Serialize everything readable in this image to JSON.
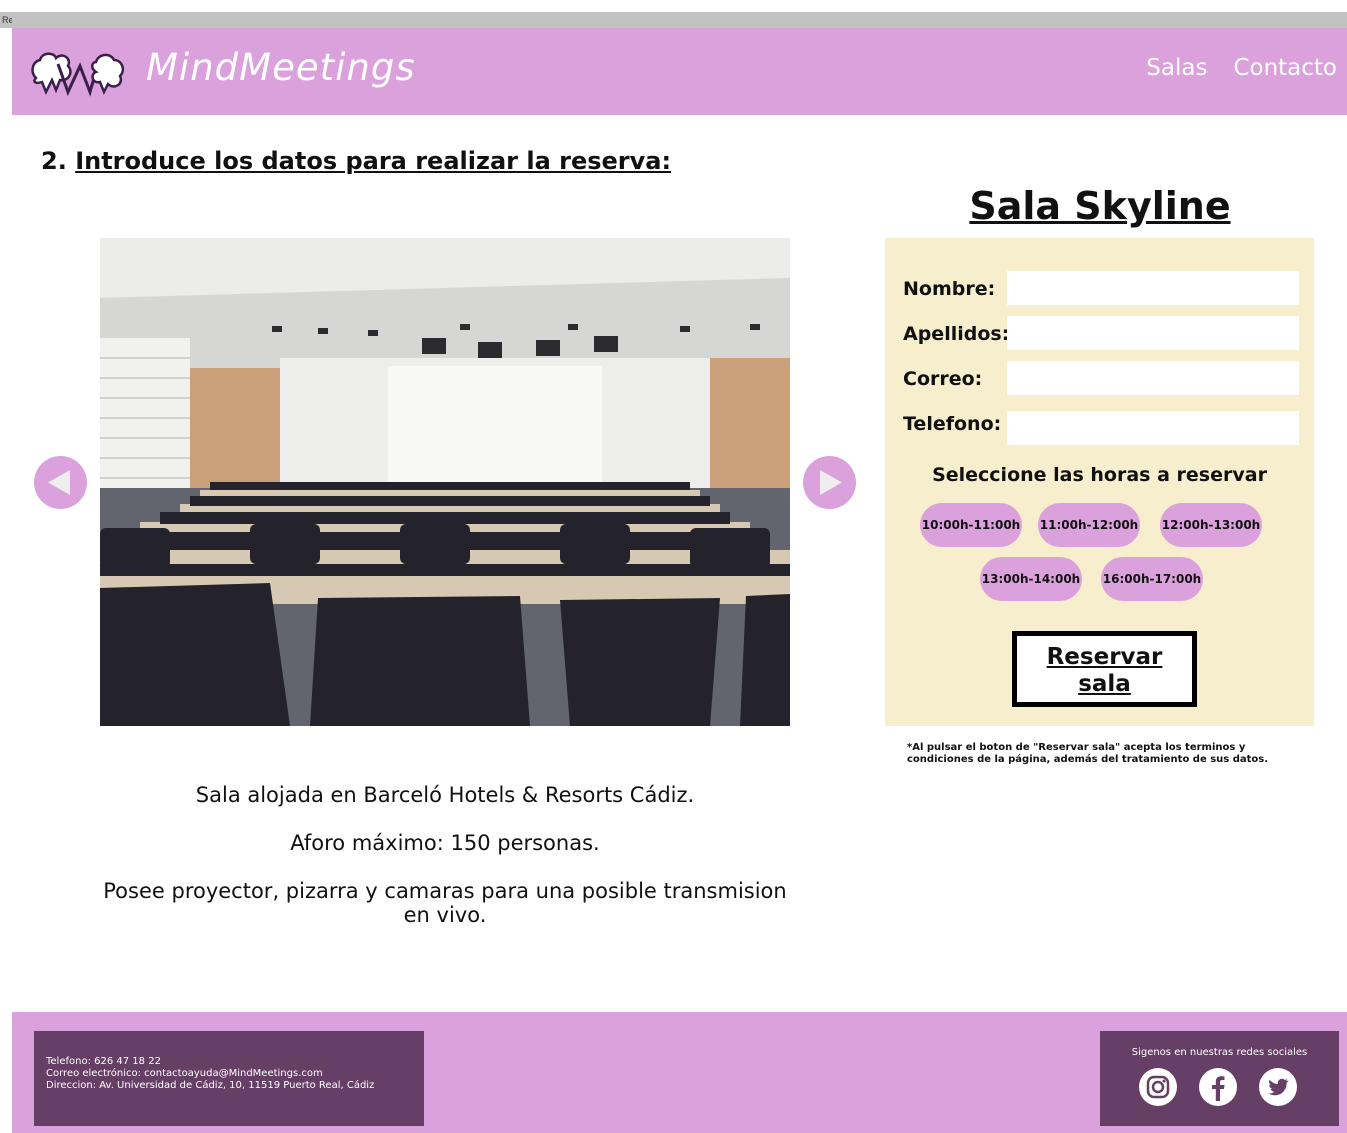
{
  "window": {
    "title": "Reserva"
  },
  "header": {
    "brand": "MindMeetings",
    "nav": [
      "Salas",
      "Contacto"
    ]
  },
  "step": {
    "number": "2.",
    "title": "Introduce los datos para realizar la reserva:"
  },
  "room": {
    "name": "Sala Skyline",
    "description": [
      "Sala alojada en Barceló Hotels & Resorts Cádiz.",
      "Aforo máximo: 150 personas.",
      "Posee proyector, pizarra y camaras para una posible transmision en vivo."
    ]
  },
  "form": {
    "fields": [
      {
        "label": "Nombre:",
        "value": ""
      },
      {
        "label": "Apellidos:",
        "value": ""
      },
      {
        "label": "Correo:",
        "value": ""
      },
      {
        "label": "Telefono:",
        "value": ""
      }
    ],
    "hours_title": "Seleccione las horas a reservar",
    "hours": [
      "10:00h-11:00h",
      "11:00h-12:00h",
      "12:00h-13:00h",
      "13:00h-14:00h",
      "16:00h-17:00h"
    ],
    "submit_line1": "Reservar",
    "submit_line2": "sala",
    "disclaimer": "*Al pulsar el boton de \"Reservar sala\" acepta los terminos y condiciones de la página, además del tratamiento de sus datos."
  },
  "footer": {
    "phone": "Telefono: 626 47 18 22",
    "email": "Correo electrónico: contactoayuda@MindMeetings.com",
    "address": "Direccion: Av. Universidad de Cádiz, 10, 11519 Puerto Real, Cádiz",
    "social_title": "Sigenos en nuestras redes sociales",
    "social_icons": [
      "instagram-icon",
      "facebook-icon",
      "twitter-icon"
    ]
  },
  "colors": {
    "brand_pink": "#dba1dc",
    "form_background": "#f6eecd",
    "footer_box": "#663f66"
  }
}
